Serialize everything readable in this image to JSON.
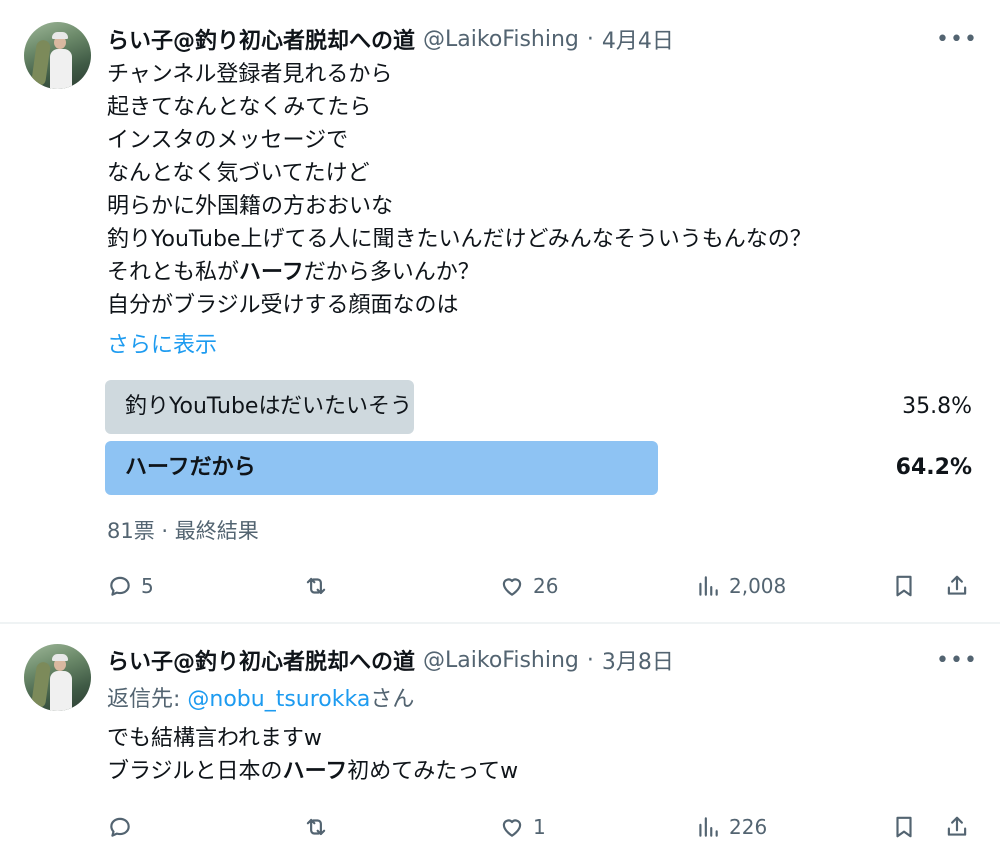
{
  "tweets": [
    {
      "author_name": "らい子@釣り初心者脱却への道",
      "handle": "@LaikoFishing",
      "separator": "·",
      "date": "4月4日",
      "more_icon": "more-horizontal-icon",
      "body_lines": [
        "チャンネル登録者見れるから",
        "起きてなんとなくみてたら",
        "インスタのメッセージで",
        "なんとなく気づいてたけど",
        "明らかに外国籍の方おおいな",
        "釣りYouTube上げてる人に聞きたいんだけどみんなそういうもんなの？"
      ],
      "line7_before": "それとも私が",
      "line7_bold": "ハーフ",
      "line7_after": "だから多いんか？",
      "line8": "自分がブラジル受けする顔面なのは",
      "show_more": "さらに表示",
      "poll": {
        "options": [
          {
            "label": "釣りYouTubeはだいたいそう",
            "percent_text": "35.8%",
            "percent": 35.8,
            "winner": false
          },
          {
            "label": "ハーフだから",
            "percent_text": "64.2%",
            "percent": 64.2,
            "winner": true
          }
        ],
        "meta": "81票 · 最終結果"
      },
      "actions": {
        "replies": "5",
        "retweets": "",
        "likes": "26",
        "views": "2,008"
      }
    },
    {
      "author_name": "らい子@釣り初心者脱却への道",
      "handle": "@LaikoFishing",
      "separator": "·",
      "date": "3月8日",
      "reply_prefix": "返信先: ",
      "reply_mention": "@nobu_tsurokka",
      "reply_suffix": "さん",
      "line1": "でも結構言われますw",
      "line2_before": "ブラジルと日本の",
      "line2_bold": "ハーフ",
      "line2_after": "初めてみたってw",
      "actions": {
        "replies": "",
        "retweets": "",
        "likes": "1",
        "views": "226"
      }
    }
  ],
  "colors": {
    "accent": "#1d9bf0",
    "secondary_text": "#536471",
    "poll_winner": "#8ec3f3",
    "poll_other": "#cfd9de"
  }
}
